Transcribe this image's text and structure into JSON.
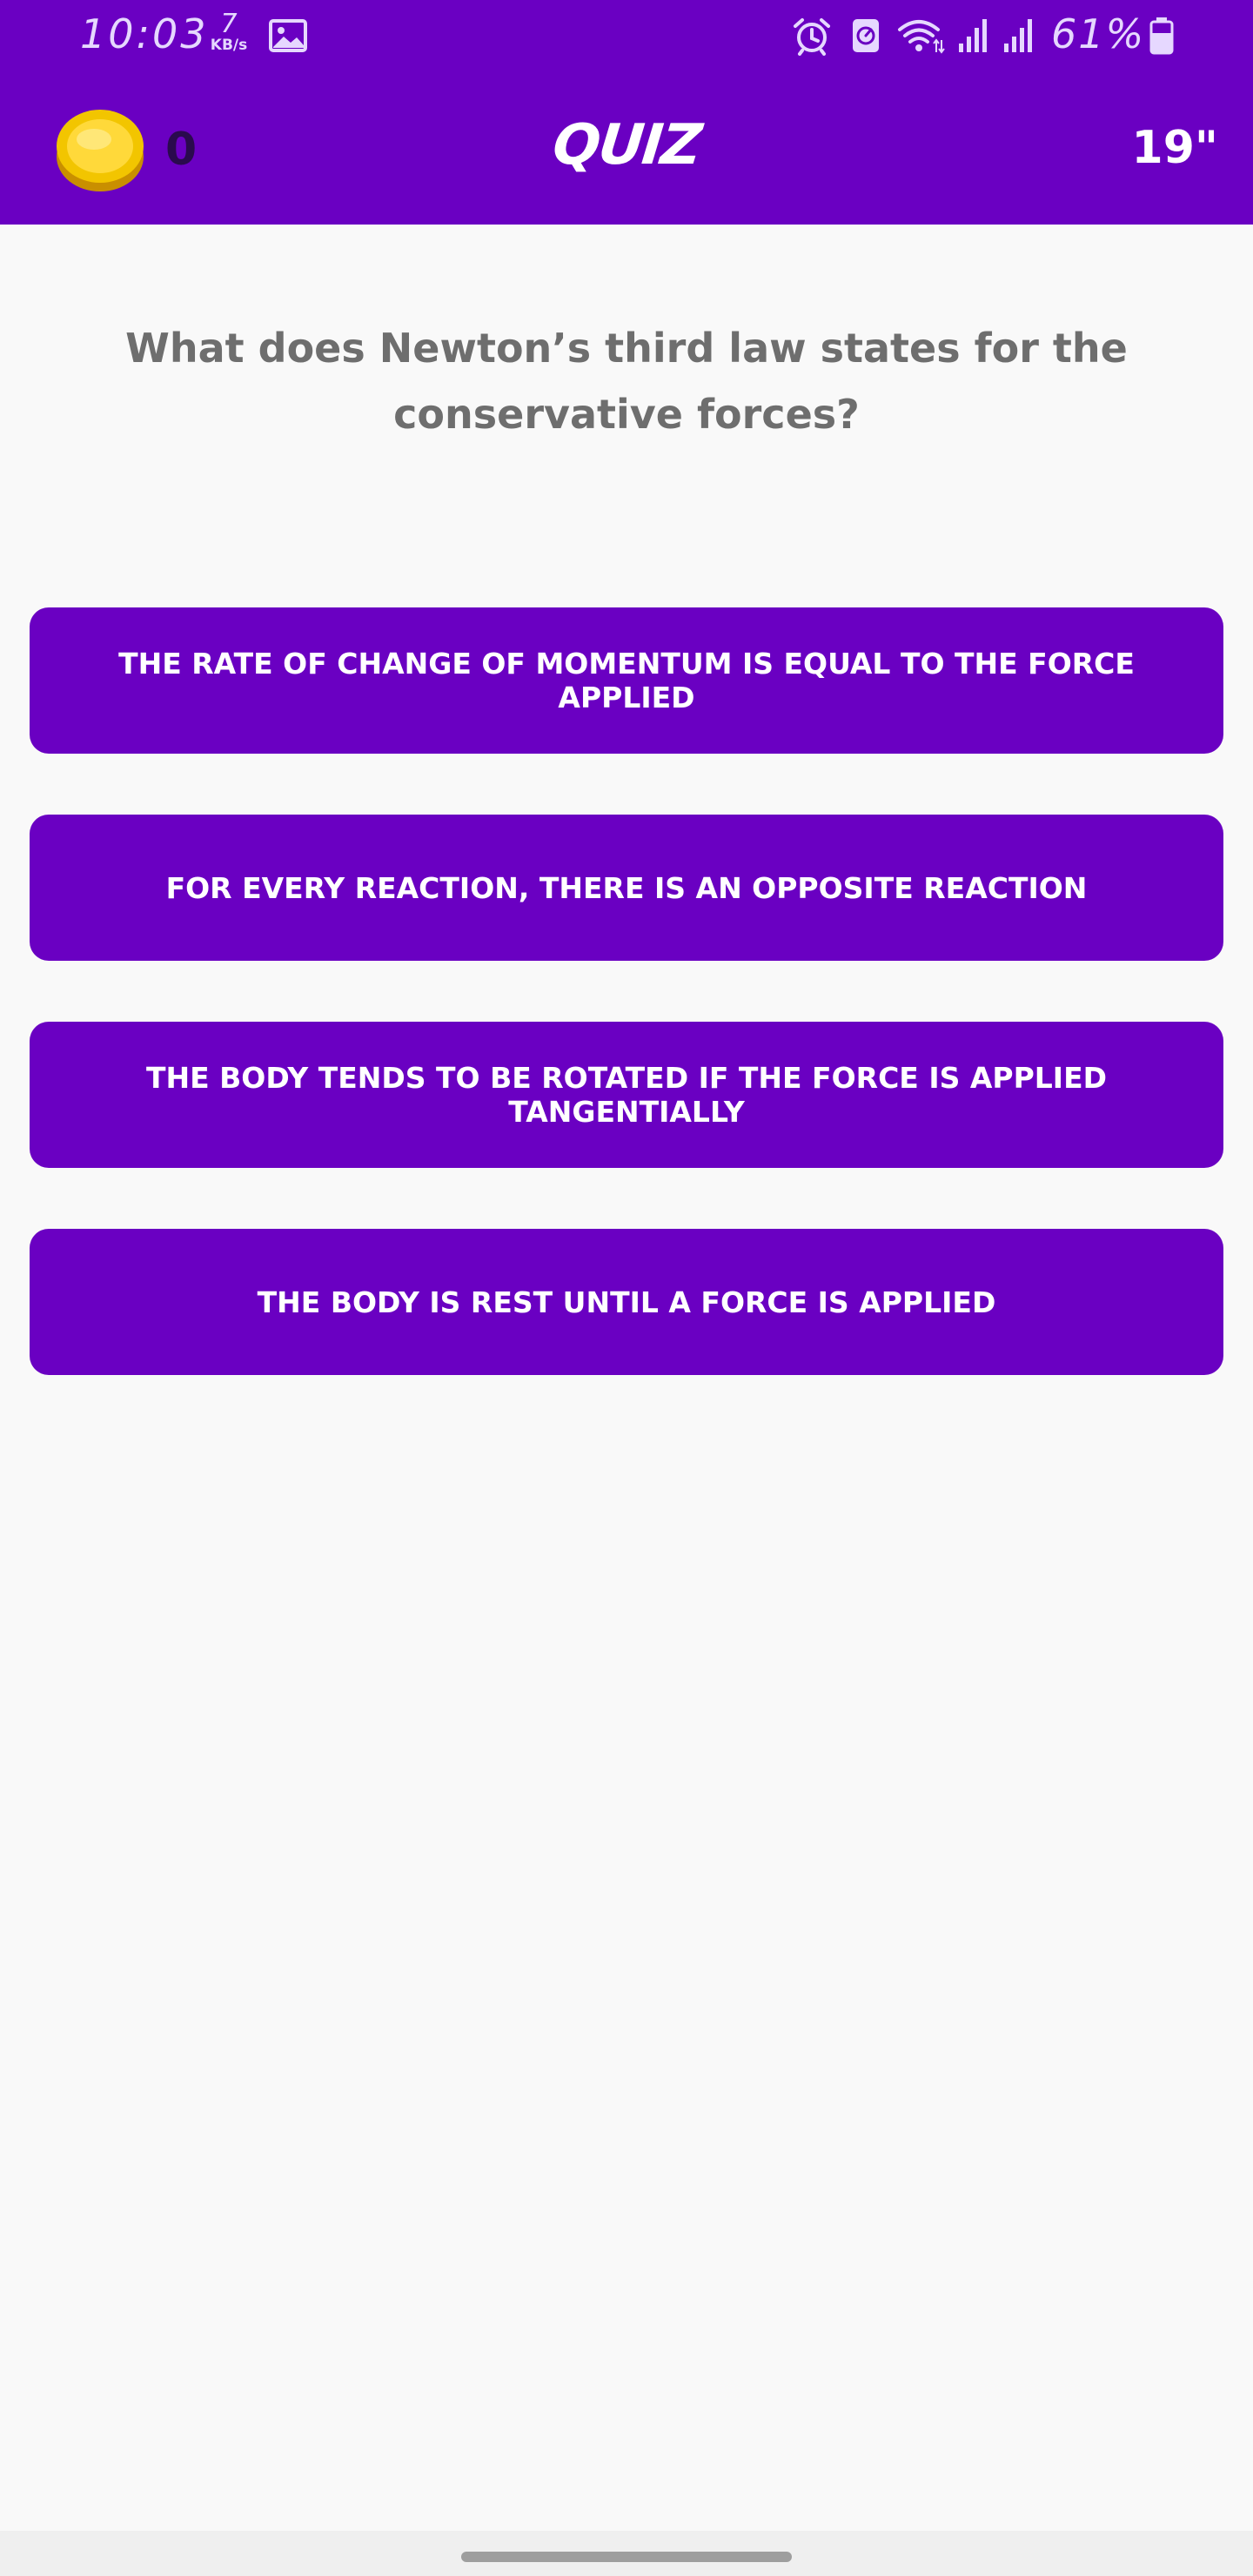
{
  "status_bar": {
    "time": "10:03",
    "speed_value": "7",
    "speed_unit": "KB/s",
    "battery_percent": "61%",
    "icons": [
      "gallery-icon",
      "alarm-icon",
      "data-saver-icon",
      "wifi-icon",
      "signal-icon",
      "signal-icon",
      "battery-icon"
    ]
  },
  "app_bar": {
    "coin_count": "0",
    "title": "QUIZ",
    "timer": "19\""
  },
  "question": {
    "text": "What does Newton’s third law states for the conservative forces?"
  },
  "answers": [
    {
      "label": "THE RATE OF CHANGE OF MOMENTUM IS EQUAL TO THE FORCE APPLIED"
    },
    {
      "label": "FOR EVERY REACTION, THERE IS AN OPPOSITE REACTION"
    },
    {
      "label": "THE BODY TENDS TO BE ROTATED IF THE FORCE IS APPLIED TANGENTIALLY"
    },
    {
      "label": "THE BODY IS REST UNTIL A FORCE IS APPLIED"
    }
  ],
  "colors": {
    "primary": "#6a00c2",
    "background": "#f9f9f9",
    "question_text": "#6e6e6e",
    "coin": "#f2c500"
  }
}
